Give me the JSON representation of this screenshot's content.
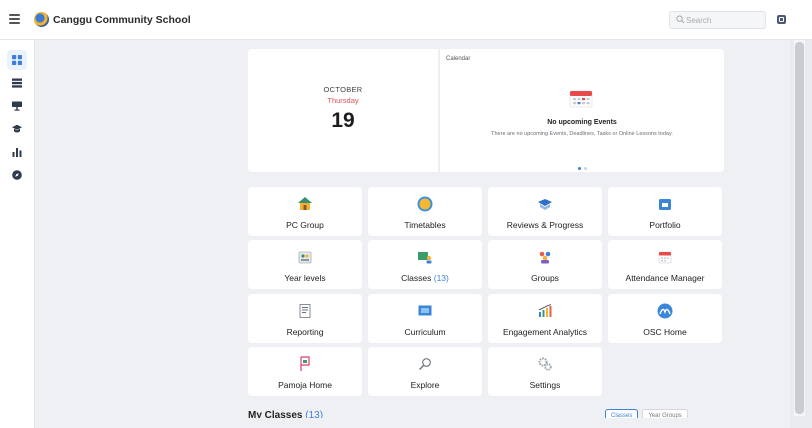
{
  "header": {
    "school_name": "Canggu Community School",
    "search_placeholder": "Search"
  },
  "sidebar": {
    "items": [
      {
        "icon": "dashboard-icon",
        "active": true
      },
      {
        "icon": "timetable-icon",
        "active": false
      },
      {
        "icon": "presentation-icon",
        "active": false
      },
      {
        "icon": "graduation-cap-icon",
        "active": false
      },
      {
        "icon": "analytics-icon",
        "active": false
      },
      {
        "icon": "compass-icon",
        "active": false
      }
    ]
  },
  "date_card": {
    "month": "OCTOBER",
    "weekday": "Thursday",
    "day": "19"
  },
  "calendar": {
    "label": "Calendar",
    "empty_title": "No upcoming Events",
    "empty_subtitle": "There are no upcoming Events, Deadlines, Tasks or Online Lessons today.",
    "carousel_pages": 2,
    "carousel_active": 1
  },
  "tiles": [
    {
      "label": "PC Group",
      "icon": "house-icon"
    },
    {
      "label": "Timetables",
      "icon": "clock-icon"
    },
    {
      "label": "Reviews & Progress",
      "icon": "book-icon"
    },
    {
      "label": "Portfolio",
      "icon": "portfolio-icon"
    },
    {
      "label": "Year levels",
      "icon": "year-levels-icon"
    },
    {
      "label": "Classes",
      "count": "(13)",
      "icon": "classes-icon"
    },
    {
      "label": "Groups",
      "icon": "groups-icon"
    },
    {
      "label": "Attendance Manager",
      "icon": "attendance-calendar-icon"
    },
    {
      "label": "Reporting",
      "icon": "report-icon"
    },
    {
      "label": "Curriculum",
      "icon": "curriculum-icon"
    },
    {
      "label": "Engagement Analytics",
      "icon": "engagement-chart-icon"
    },
    {
      "label": "OSC Home",
      "icon": "osc-icon"
    },
    {
      "label": "Pamoja Home",
      "icon": "pamoja-icon"
    },
    {
      "label": "Explore",
      "icon": "explore-icon"
    },
    {
      "label": "Settings",
      "icon": "settings-gears-icon"
    }
  ],
  "my_classes": {
    "title": "My Classes",
    "count": "(13)",
    "view_classes_label": "Classes",
    "view_year_groups_label": "Year Groups"
  },
  "colors": {
    "accent": "#3f7fd9",
    "weekday_red": "#e2525a",
    "background": "#eef0f3"
  }
}
